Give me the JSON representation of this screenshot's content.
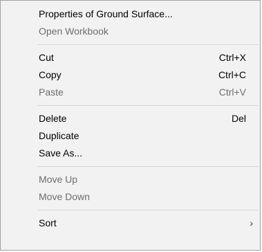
{
  "menu": {
    "items": [
      {
        "label": "Properties of  Ground Surface...",
        "shortcut": "",
        "enabled": true
      },
      {
        "label": "Open Workbook",
        "shortcut": "",
        "enabled": false
      },
      {
        "label": "Cut",
        "shortcut": "Ctrl+X",
        "enabled": true
      },
      {
        "label": "Copy",
        "shortcut": "Ctrl+C",
        "enabled": true
      },
      {
        "label": "Paste",
        "shortcut": "Ctrl+V",
        "enabled": false
      },
      {
        "label": "Delete",
        "shortcut": "Del",
        "enabled": true
      },
      {
        "label": "Duplicate",
        "shortcut": "",
        "enabled": true
      },
      {
        "label": "Save As...",
        "shortcut": "",
        "enabled": true
      },
      {
        "label": "Move Up",
        "shortcut": "",
        "enabled": false
      },
      {
        "label": "Move Down",
        "shortcut": "",
        "enabled": false
      },
      {
        "label": "Sort",
        "shortcut": "",
        "enabled": true,
        "submenu_arrow": "›"
      }
    ]
  }
}
